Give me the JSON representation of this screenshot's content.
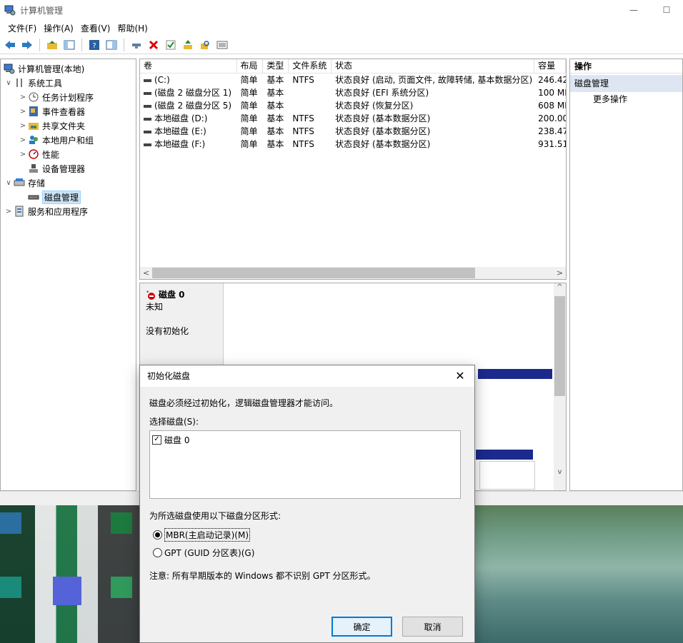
{
  "window": {
    "title": "计算机管理",
    "minimize_glyph": "—",
    "maximize_glyph": "☐"
  },
  "menu": [
    "文件(F)",
    "操作(A)",
    "查看(V)",
    "帮助(H)"
  ],
  "tree": {
    "items": [
      {
        "label": "计算机管理(本地)",
        "icon": "computer-management-icon",
        "chevron": ""
      },
      {
        "label": "系统工具",
        "icon": "tools-icon",
        "chevron": "∨"
      },
      {
        "label": "任务计划程序",
        "icon": "clock-icon",
        "chevron": ">"
      },
      {
        "label": "事件查看器",
        "icon": "event-viewer-icon",
        "chevron": ">"
      },
      {
        "label": "共享文件夹",
        "icon": "shared-folder-icon",
        "chevron": ">"
      },
      {
        "label": "本地用户和组",
        "icon": "users-icon",
        "chevron": ">"
      },
      {
        "label": "性能",
        "icon": "performance-icon",
        "chevron": ">"
      },
      {
        "label": "设备管理器",
        "icon": "device-manager-icon",
        "chevron": ""
      },
      {
        "label": "存储",
        "icon": "storage-icon",
        "chevron": "∨"
      },
      {
        "label": "磁盘管理",
        "icon": "disk-management-icon",
        "chevron": ""
      },
      {
        "label": "服务和应用程序",
        "icon": "services-icon",
        "chevron": ">"
      }
    ]
  },
  "volumes": {
    "headers": [
      "卷",
      "布局",
      "类型",
      "文件系统",
      "状态",
      "容量"
    ],
    "rows": [
      [
        "(C:)",
        "简单",
        "基本",
        "NTFS",
        "状态良好 (启动, 页面文件, 故障转储, 基本数据分区)",
        "246.42"
      ],
      [
        "(磁盘 2 磁盘分区 1)",
        "简单",
        "基本",
        "",
        "状态良好 (EFI 系统分区)",
        "100 MB"
      ],
      [
        "(磁盘 2 磁盘分区 5)",
        "简单",
        "基本",
        "",
        "状态良好 (恢复分区)",
        "608 MB"
      ],
      [
        "本地磁盘 (D:)",
        "简单",
        "基本",
        "NTFS",
        "状态良好 (基本数据分区)",
        "200.00"
      ],
      [
        "本地磁盘 (E:)",
        "简单",
        "基本",
        "NTFS",
        "状态良好 (基本数据分区)",
        "238.47"
      ],
      [
        "本地磁盘 (F:)",
        "简单",
        "基本",
        "NTFS",
        "状态良好 (基本数据分区)",
        "931.51"
      ]
    ]
  },
  "disk0": {
    "name": "磁盘 0",
    "type": "未知",
    "state": "没有初始化"
  },
  "actions": {
    "header": "操作",
    "group": "磁盘管理",
    "more": "更多操作"
  },
  "dialog": {
    "title": "初始化磁盘",
    "message": "磁盘必须经过初始化，逻辑磁盘管理器才能访问。",
    "select_label": "选择磁盘(S):",
    "disk_item": "磁盘 0",
    "partition_label": "为所选磁盘使用以下磁盘分区形式:",
    "mbr_label": "MBR(主启动记录)(M)",
    "gpt_label": "GPT (GUID 分区表)(G)",
    "note": "注意: 所有早期版本的 Windows 都不识别 GPT 分区形式。",
    "ok": "确定",
    "cancel": "取消",
    "selected_partition_style": "MBR"
  },
  "colors": {
    "accent": "#0078d7",
    "selection": "#cce4f7",
    "disk_bar": "#1b2a8c",
    "error_red": "#d00000"
  }
}
